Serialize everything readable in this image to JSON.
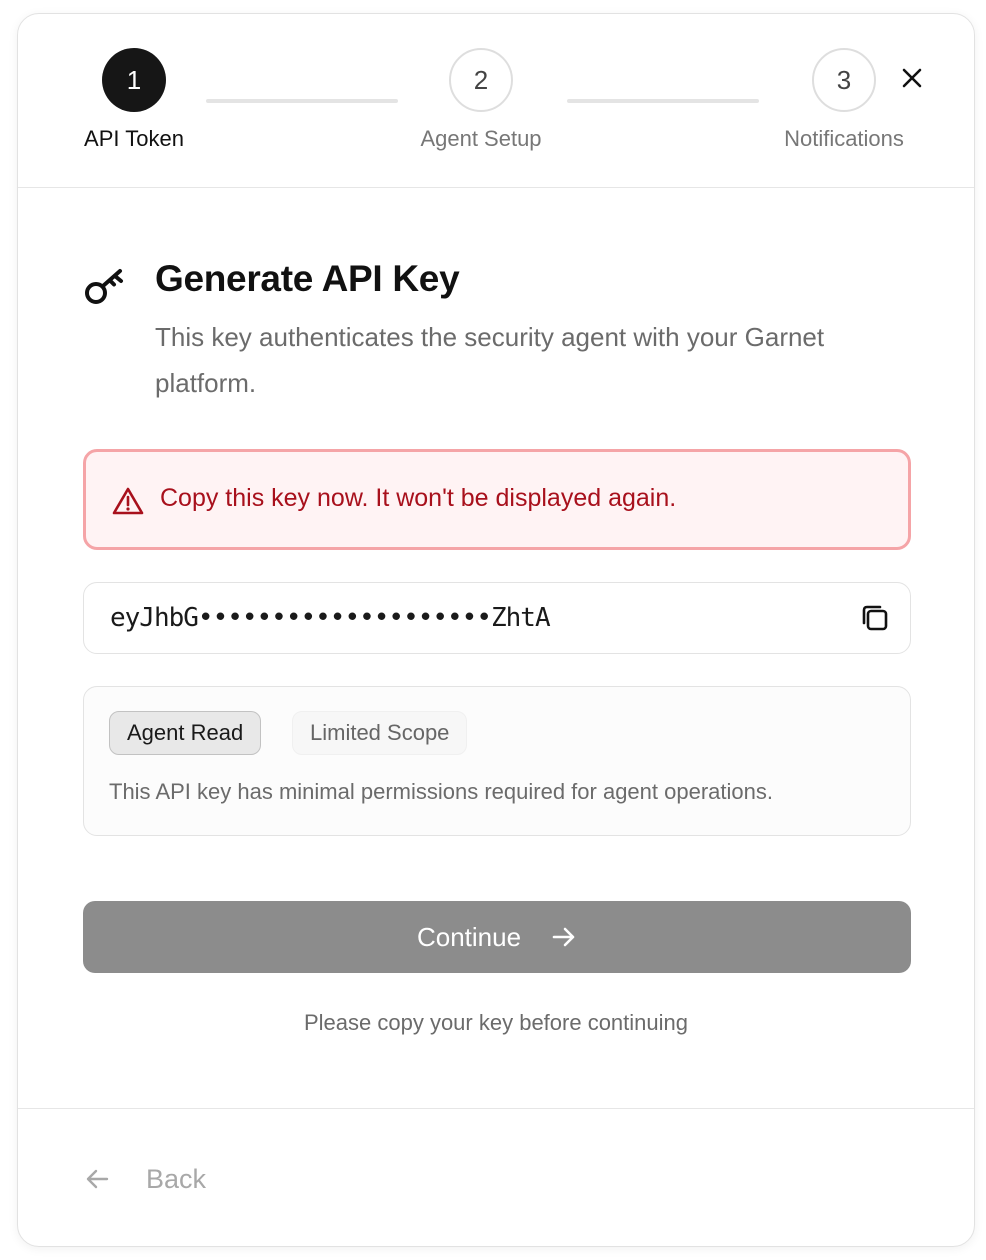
{
  "stepper": {
    "steps": [
      {
        "number": "1",
        "label": "API Token",
        "state": "active"
      },
      {
        "number": "2",
        "label": "Agent Setup",
        "state": "inactive"
      },
      {
        "number": "3",
        "label": "Notifications",
        "state": "inactive"
      }
    ],
    "close_icon": "close-icon"
  },
  "header": {
    "icon": "key-icon",
    "title": "Generate API Key",
    "subtitle": "This key authenticates the security agent with your Garnet platform."
  },
  "alert": {
    "icon": "warning-icon",
    "text": "Copy this key now. It won't be displayed again."
  },
  "api_key": {
    "masked_value": "eyJhbG••••••••••••••••••••ZhtA",
    "copy_icon": "copy-icon"
  },
  "permissions": {
    "chips": [
      "Agent Read",
      "Limited Scope"
    ],
    "description": "This API key has minimal permissions required for agent operations."
  },
  "actions": {
    "continue_label": "Continue",
    "continue_icon": "arrow-right-icon",
    "hint": "Please copy your key before continuing",
    "back_label": "Back",
    "back_icon": "arrow-left-icon"
  },
  "colors": {
    "active_step": "#161616",
    "alert_text": "#a8101c",
    "alert_border": "#f5a4a7",
    "alert_bg": "#fff3f4",
    "continue_disabled": "#8c8c8c"
  }
}
